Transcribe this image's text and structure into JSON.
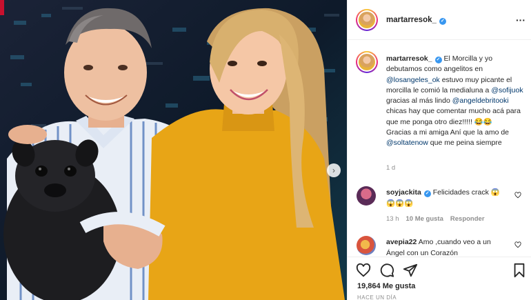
{
  "header": {
    "username": "martarresok_",
    "more_icon": "more-horizontal-icon"
  },
  "caption": {
    "username": "martarresok_",
    "part1": " El Morcilla y yo debutamos como angelitos en ",
    "mention1": "@losangeles_ok",
    "part2": " estuvo muy picante el morcilla le comió la medialuna a ",
    "mention2": "@sofijuok",
    "part3": " gracias al más lindo ",
    "mention3": "@angeldebritooki",
    "part4": " chicas hay que comentar mucho acá para que me ponga otro diez!!!!! 😂😂",
    "part5": "Gracias a mi amiga Aní que la amo de ",
    "mention4": "@soltatenow",
    "part6": " que me peina siempre",
    "time": "1 d"
  },
  "comments": [
    {
      "username": "soyjackita",
      "text": " Felicidades crack 😱",
      "text2": "😱😱😱",
      "time": "13 h",
      "likes": "10 Me gusta",
      "reply": "Responder"
    },
    {
      "username": "avepia22",
      "text": " Amo ,cuando veo a un Ángel con un Corazón"
    }
  ],
  "actions": {
    "likes": "19,864 Me gusta",
    "age": "HACE UN DÍA"
  },
  "colors": {
    "verified": "#3897f0",
    "mention": "#00376b",
    "meta": "#8e8e8e"
  }
}
